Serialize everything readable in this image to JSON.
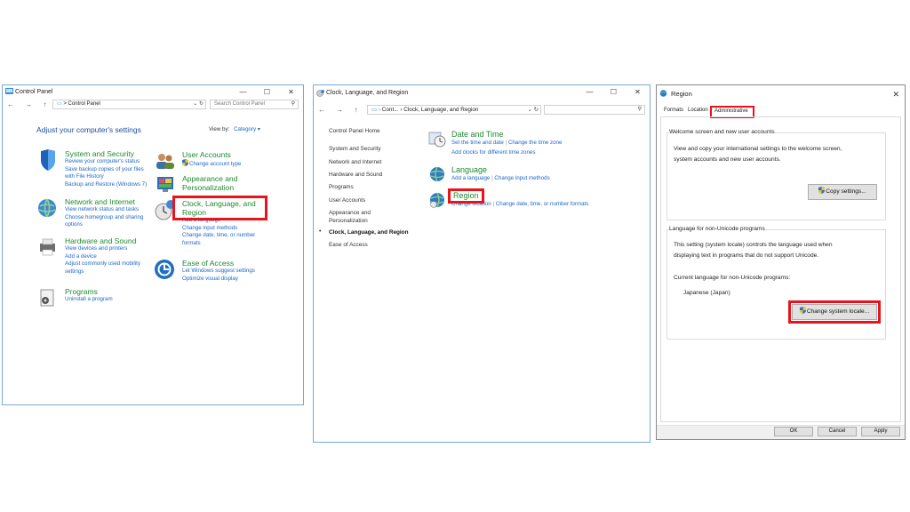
{
  "w1": {
    "title": "Control Panel",
    "controls": {
      "minimize": "—",
      "maximize": "☐",
      "close": "✕"
    },
    "nav": "← → ↑",
    "path": "Control Panel",
    "path_sep": ">",
    "search_placeholder": "Search Control Panel",
    "heading": "Adjust your computer's settings",
    "viewby_label": "View by:",
    "viewby_value": "Category ▾",
    "system": {
      "title": "System and Security",
      "links": [
        "Review your computer's status",
        "Save backup copies of your files",
        "with File History",
        "Backup and Restore (Windows 7)"
      ]
    },
    "network": {
      "title": "Network and Internet",
      "links": [
        "View network status and tasks",
        "Choose homegroup and sharing",
        "options"
      ]
    },
    "hardware": {
      "title": "Hardware and Sound",
      "links": [
        "View devices and printers",
        "Add a device",
        "Adjust commonly used mobility",
        "settings"
      ]
    },
    "programs": {
      "title": "Programs",
      "links": [
        "Uninstall a program"
      ]
    },
    "accounts": {
      "title": "User Accounts",
      "links": [
        "Change account type"
      ]
    },
    "appearance": {
      "title_1": "Appearance and",
      "title_2": "Personalization"
    },
    "clock": {
      "title_1": "Clock, Language, and",
      "title_2": "Region",
      "links": [
        "Add a language",
        "Change input methods",
        "Change date, time, or number",
        "formats"
      ]
    },
    "ease": {
      "title": "Ease of Access",
      "links": [
        "Let Windows suggest settings",
        "Optimize visual display"
      ]
    }
  },
  "w2": {
    "title": "Clock, Language, and Region",
    "controls": {
      "minimize": "—",
      "maximize": "☐",
      "close": "✕"
    },
    "nav": "← → ↑",
    "path_1": "Cont...",
    "path_2": "Clock, Language, and Region",
    "sidebar": [
      "Control Panel Home",
      "System and Security",
      "Network and Internet",
      "Hardware and Sound",
      "Programs",
      "User Accounts",
      "Appearance and",
      "Personalization",
      "Clock, Language, and Region",
      "Ease of Access"
    ],
    "datetime": {
      "title": "Date and Time",
      "link_1": "Set the time and date",
      "link_2": "Change the time zone",
      "link_3": "Add clocks for different time zones"
    },
    "language": {
      "title": "Language",
      "link_1": "Add a language",
      "link_2": "Change input methods"
    },
    "region": {
      "title": "Region",
      "link_1": "Change location",
      "link_2": "Change date, time, or number formats"
    }
  },
  "w3": {
    "title": "Region",
    "close": "✕",
    "tabs": [
      "Formats",
      "Location",
      "Administrative"
    ],
    "welcome_title": "Welcome screen and new user accounts",
    "welcome_text_1": "View and copy your international settings to the welcome screen,",
    "welcome_text_2": "system accounts and new user accounts.",
    "copy_button": "Copy settings...",
    "nonunicode_title": "Language for non-Unicode programs",
    "nonunicode_text_1": "This setting (system locale) controls the language used when",
    "nonunicode_text_2": "displaying text in programs that do not support Unicode.",
    "current_label": "Current language for non-Unicode programs:",
    "current_value": "Japanese (Japan)",
    "change_button": "Change system locale...",
    "ok": "OK",
    "cancel": "Cancel",
    "apply": "Apply"
  },
  "colors": {
    "highlight": "#e8131b",
    "link": "#1e67c8",
    "category": "#1f8a2e",
    "window_border": "#7aa7d6"
  }
}
